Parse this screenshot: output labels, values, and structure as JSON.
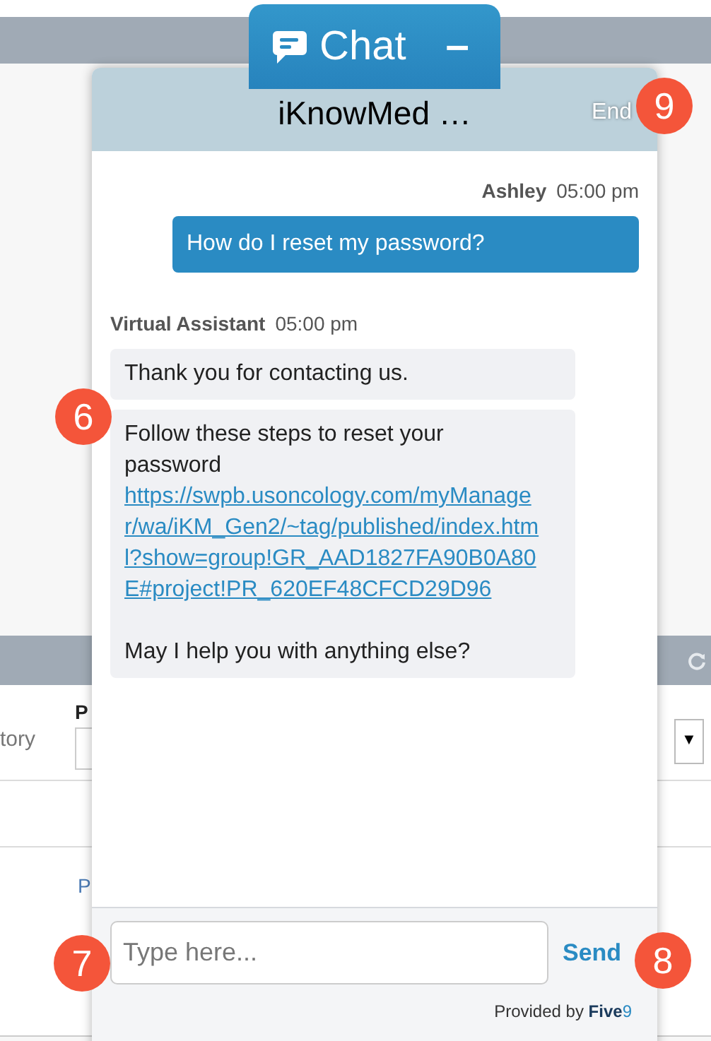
{
  "background": {
    "row_label": "tory",
    "field_label": "P",
    "column_label": "P",
    "dropdown_arrow": "▼"
  },
  "chat_tab": {
    "title": "Chat",
    "minimize": "–"
  },
  "header": {
    "title": "iKnowMed …",
    "end_button": "End"
  },
  "messages": [
    {
      "kind": "user",
      "sender": "Ashley",
      "time": "05:00 pm",
      "bubbles": [
        {
          "text": "How do I reset my password?"
        }
      ]
    },
    {
      "kind": "agent",
      "sender": "Virtual Assistant",
      "time": "05:00 pm",
      "bubbles": [
        {
          "text": "Thank you for contacting us."
        },
        {
          "text": "Follow these steps to reset your password",
          "link": "https://swpb.usoncology.com/myManager/wa/iKM_Gen2/~tag/published/index.html?show=group!GR_AAD1827FA90B0A80E#project!PR_620EF48CFCD29D96",
          "after": "May I help you with anything else?"
        }
      ]
    }
  ],
  "composer": {
    "placeholder": "Type here...",
    "send": "Send"
  },
  "footer": {
    "provided_by": "Provided by",
    "brand_main": "Five",
    "brand_accent": "9"
  },
  "callouts": [
    {
      "text": "9"
    },
    {
      "text": "6"
    },
    {
      "text": "7"
    },
    {
      "text": "8"
    }
  ]
}
